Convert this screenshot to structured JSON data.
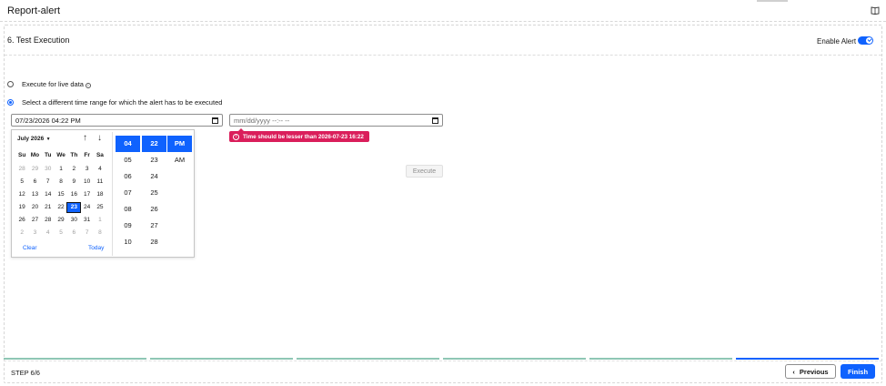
{
  "app": {
    "title": "Report-alert",
    "icon": "book-icon"
  },
  "header": {
    "enable_label": "Enable Alert",
    "enable_on": true
  },
  "section": {
    "title": "6. Test Execution"
  },
  "options": {
    "live": {
      "label": "Execute for live data",
      "selected": false
    },
    "range": {
      "label": "Select a different time range for which the alert has to be executed",
      "selected": true
    }
  },
  "start_input": {
    "value": "07/23/2026 04:22 PM"
  },
  "end_input": {
    "placeholder": "mm/dd/yyyy --:-- --"
  },
  "error_tooltip": {
    "text": "Time should be lesser than 2026-07-23 16:22"
  },
  "calendar": {
    "month_label": "July 2026",
    "weekdays": [
      "Su",
      "Mo",
      "Tu",
      "We",
      "Th",
      "Fr",
      "Sa"
    ],
    "weeks": [
      [
        "28",
        "29",
        "30",
        "1",
        "2",
        "3",
        "4"
      ],
      [
        "5",
        "6",
        "7",
        "8",
        "9",
        "10",
        "11"
      ],
      [
        "12",
        "13",
        "14",
        "15",
        "16",
        "17",
        "18"
      ],
      [
        "19",
        "20",
        "21",
        "22",
        "23",
        "24",
        "25"
      ],
      [
        "26",
        "27",
        "28",
        "29",
        "30",
        "31",
        "1"
      ],
      [
        "2",
        "3",
        "4",
        "5",
        "6",
        "7",
        "8"
      ]
    ],
    "selected_day": "23",
    "clear_label": "Clear",
    "today_label": "Today"
  },
  "time": {
    "hours": [
      "04",
      "05",
      "06",
      "07",
      "08",
      "09",
      "10"
    ],
    "minutes": [
      "22",
      "23",
      "24",
      "25",
      "26",
      "27",
      "28"
    ],
    "ampm": [
      "PM",
      "AM"
    ],
    "selected_hour": "04",
    "selected_minute": "22",
    "selected_ampm": "PM"
  },
  "execute_button": {
    "label": "Execute",
    "disabled": true
  },
  "footer": {
    "step_label": "STEP 6/6",
    "total_steps": 6,
    "current_step": 6,
    "previous_label": "Previous",
    "finish_label": "Finish"
  },
  "colors": {
    "accent": "#0f62fe",
    "error": "#da1e5b",
    "step_done": "#8fc7b5"
  }
}
